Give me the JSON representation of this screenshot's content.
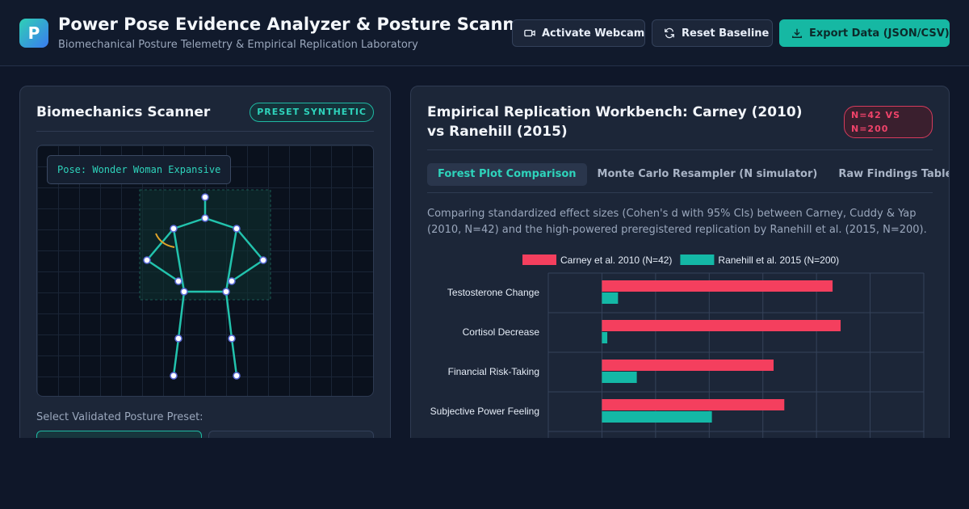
{
  "header": {
    "logo_letter": "P",
    "title": "Power Pose Evidence Analyzer & Posture Scanner",
    "subtitle": "Biomechanical Posture Telemetry & Empirical Replication Laboratory",
    "buttons": {
      "webcam": "Activate Webcam",
      "reset": "Reset Baseline",
      "export": "Export Data (JSON/CSV)"
    }
  },
  "scanner_panel": {
    "title": "Biomechanics Scanner",
    "badge": "PRESET SYNTHETIC",
    "pose_label": "Pose: Wonder Woman Expansive",
    "preset_label": "Select Validated Posture Preset:"
  },
  "workbench": {
    "title": "Empirical Replication Workbench: Carney (2010) vs Ranehill (2015)",
    "badge": "N=42 VS N=200",
    "tabs": [
      {
        "label": "Forest Plot Comparison",
        "active": true
      },
      {
        "label": "Monte Carlo Resampler (N simulator)",
        "active": false
      },
      {
        "label": "Raw Findings Table",
        "active": false
      }
    ],
    "description": "Comparing standardized effect sizes (Cohen's d with 95% CIs) between Carney, Cuddy & Yap (2010, N=42) and the high-powered preregistered replication by Ranehill et al. (2015, N=200)."
  },
  "colors": {
    "accent": "#16b8a3",
    "carney": "#f43f5e",
    "ranehill": "#14b8a6"
  },
  "chart_data": {
    "type": "bar",
    "orientation": "horizontal",
    "categories": [
      "Testosterone Change",
      "Cortisol Decrease",
      "Financial Risk-Taking",
      "Subjective Power Feeling"
    ],
    "series": [
      {
        "name": "Carney et al. 2010 (N=42)",
        "color": "#f43f5e",
        "values": [
          0.86,
          0.89,
          0.64,
          0.68
        ]
      },
      {
        "name": "Ranehill et al. 2015 (N=200)",
        "color": "#14b8a6",
        "values": [
          0.06,
          0.02,
          0.13,
          0.41
        ]
      }
    ],
    "xlim": [
      -0.2,
      1.2
    ],
    "grid": true,
    "legend": "top"
  }
}
